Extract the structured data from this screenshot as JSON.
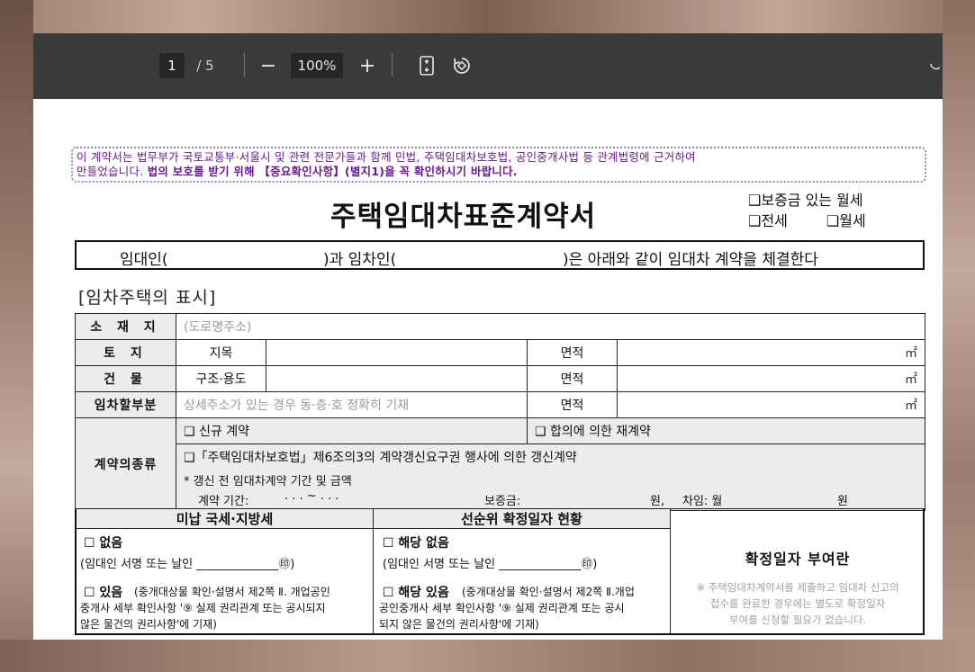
{
  "toolbar": {
    "page_current": "1",
    "page_total": "/ 5",
    "zoom_out": "−",
    "zoom": "100%",
    "zoom_in": "+",
    "fit_icon": "fit-page-icon",
    "rotate_icon": "rotate-icon"
  },
  "notice": {
    "line1": "이 계약서는 법무부가 국토교통부·서울시 및 관련 전문가들과 함께 민법, 주택임대차보호법, 공인중개사법 등 관계법령에 근거하여",
    "line2_a": "만들었습니다.",
    "line2_b": "법의 보호를 받기 위해 【중요확인사항】(별지1)을 꼭 확인하시기 바랍니다."
  },
  "title": "주택임대차표준계약서",
  "contract_types": {
    "jeonse_monthly": "❑보증금 있는 월세",
    "jeonse": "❑전세",
    "monthly": "❑월세"
  },
  "statement": {
    "landlord": "임대인(",
    "tenant": ")과 임차인(",
    "rest": ")은 아래와 같이 임대차 계약을 체결한다"
  },
  "section_title": "[임차주택의 표시]",
  "property": {
    "location_label": "소 재 지",
    "location_placeholder": "(도로명주소)",
    "land_label": "토 지",
    "land_sub": "지목",
    "building_label": "건 물",
    "building_sub": "구조·용도",
    "rental_label": "임차할부분",
    "rental_placeholder": "상세주소가 있는 경우 동·층·호 정확히 기재",
    "area_label": "면적",
    "unit": "㎡"
  },
  "contract_kind": {
    "label": "계약의종류",
    "new": "❑ 신규 계약",
    "renew": "❑ 합의에 의한 재계약",
    "renewal_right": "❑「주택임대차보호법」제6조의3의 계약갱신요구권 행사에 의한 갱신계약",
    "note": "* 갱신 전 임대차계약 기간 및 금액",
    "period_label": "계약 기간:",
    "period_dots": ".    .    .  ~    .    .    .",
    "deposit": "보증금:",
    "won": "원,",
    "rent": "차임: 월",
    "won2": "원"
  },
  "lower": {
    "tax_header": "미납 국세·지방세",
    "tax_none": "☐ 없음",
    "tax_sign": "(임대인 서명 또는 날인 ______________㊞)",
    "tax_yes": "☐ 있음",
    "tax_yes_desc1": "(중개대상물 확인·설명서 제2쪽 Ⅱ. 개업공인",
    "tax_yes_desc2": "중개사 세부 확인사항 '⑨ 실제 권리관계 또는 공시되지",
    "tax_yes_desc3": "않은 물건의 권리사항'에 기재)",
    "priority_header": "선순위 확정일자 현황",
    "priority_none": "☐ 해당 없음",
    "priority_sign": "(임대인 서명 또는 날인 ______________㊞)",
    "priority_yes": "☐ 해당 있음",
    "priority_yes_desc1": "(중개대상물 확인·설명서 제2쪽 Ⅱ.개업",
    "priority_yes_desc2": "공인중개사 세부 확인사항 '⑨ 실제 권리관계 또는 공시",
    "priority_yes_desc3": "되지 않은 물건의 권리사항'에 기재)",
    "confirm_header": "확정일자 부여란",
    "confirm_note1": "※ 주택임대차계약서를 제출하고 임대차 신고의",
    "confirm_note2": "접수를 완료한 경우에는 별도로 확정일자",
    "confirm_note3": "부여를 신청할 필요가 없습니다."
  }
}
